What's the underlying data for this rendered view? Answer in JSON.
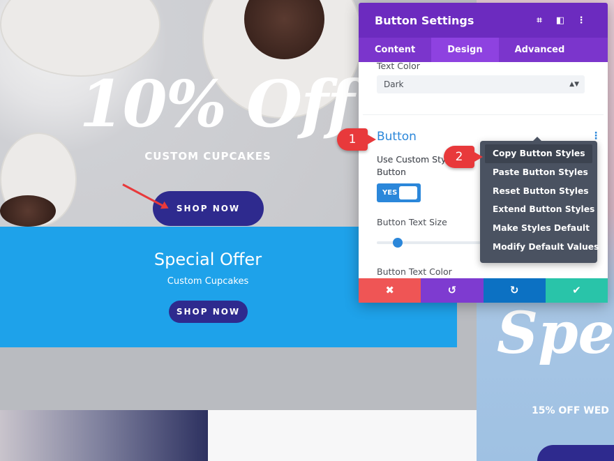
{
  "hero": {
    "title": "10% Off",
    "subtitle": "CUSTOM CUPCAKES",
    "button": "SHOP NOW"
  },
  "offer": {
    "title": "Special Offer",
    "subtitle": "Custom Cupcakes",
    "button": "SHOP NOW",
    "color": "#1ea2ea"
  },
  "right_column": {
    "title": "Spe",
    "subtitle": "15% OFF WED"
  },
  "panel": {
    "title": "Button Settings",
    "icons": [
      "focus-icon",
      "split-view-icon",
      "more-vertical-icon"
    ],
    "tabs": [
      {
        "label": "Content"
      },
      {
        "label": "Design",
        "active": true
      },
      {
        "label": "Advanced"
      }
    ],
    "text_color_label": "Text Color",
    "text_color_value": "Dark",
    "section_title": "Button",
    "use_custom_label": "Use Custom Styles For Button",
    "use_custom_line1": "Use Custom Styl",
    "use_custom_line2": "Button",
    "toggle_label": "YES",
    "text_size_label": "Button Text Size",
    "text_size_value": 0.1,
    "text_color2_label": "Button Text Color",
    "footer": {
      "cancel": "✖",
      "undo": "↺",
      "redo": "↻",
      "save": "✔"
    },
    "colors": {
      "header": "#6c2bbf",
      "tabs": "#7b35cc",
      "cancel": "#ef5555",
      "undo": "#7e3bd0",
      "redo": "#0c71c3",
      "save": "#29c4a9"
    }
  },
  "menu": {
    "items": [
      {
        "label": "Copy Button Styles",
        "highlighted": true
      },
      {
        "label": "Paste Button Styles"
      },
      {
        "label": "Reset Button Styles"
      },
      {
        "label": "Extend Button Styles"
      },
      {
        "label": "Make Styles Default"
      },
      {
        "label": "Modify Default Values"
      }
    ]
  },
  "callouts": [
    "1",
    "2"
  ]
}
